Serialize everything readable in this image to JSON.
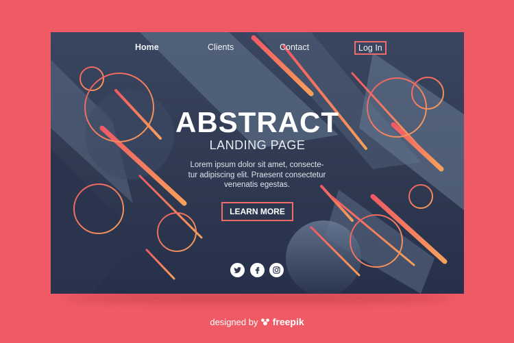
{
  "nav": {
    "items": [
      {
        "label": "Home"
      },
      {
        "label": "Clients"
      },
      {
        "label": "Contact"
      }
    ],
    "login_label": "Log In"
  },
  "hero": {
    "title": "ABSTRACT",
    "subtitle": "LANDING PAGE",
    "body_lines": [
      "Lorem ipsum dolor sit amet, consecte-",
      "tur adipiscing elit. Praesent consectetur",
      "venenatis egestas."
    ],
    "cta_label": "LEARN MORE"
  },
  "social": {
    "icons": [
      "twitter-icon",
      "facebook-icon",
      "instagram-icon"
    ]
  },
  "footer": {
    "credit_prefix": "designed by",
    "credit_brand": "freepik"
  },
  "colors": {
    "page_background": "#f05a64",
    "card_background": "#2f3950",
    "accent": "#f06b6b",
    "accent_gradient_end": "#f7b15a"
  }
}
